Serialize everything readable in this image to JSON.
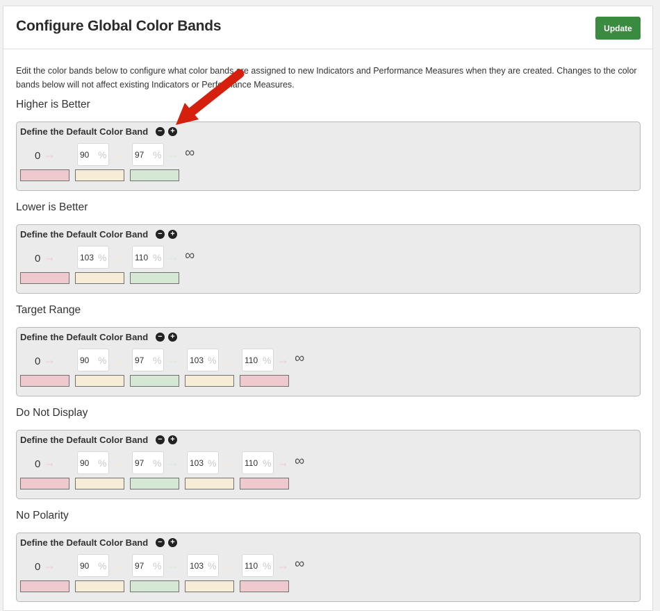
{
  "header": {
    "title": "Configure Global Color Bands",
    "update_label": "Update"
  },
  "description": "Edit the color bands below to configure what color bands are assigned to new Indicators and Performance Measures when they are created. Changes to the color bands below will not affect existing Indicators or Performance Measures.",
  "band_label": "Define the Default Color Band",
  "colors": {
    "red": "#efc9cd",
    "yellow": "#f7ecd6",
    "green": "#d4e8d3",
    "accent": "#3a8a3f"
  },
  "sections": [
    {
      "title": "Higher is Better",
      "start": "0",
      "thresholds": [
        "90",
        "97"
      ],
      "bands": [
        "red",
        "yellow",
        "green"
      ],
      "end": "∞"
    },
    {
      "title": "Lower is Better",
      "start": "0",
      "thresholds": [
        "103",
        "110"
      ],
      "bands": [
        "red",
        "yellow",
        "green"
      ],
      "end": "∞"
    },
    {
      "title": "Target Range",
      "start": "0",
      "thresholds": [
        "90",
        "97",
        "103",
        "110"
      ],
      "bands": [
        "red",
        "yellow",
        "green",
        "yellow",
        "red"
      ],
      "end": "∞"
    },
    {
      "title": "Do Not Display",
      "start": "0",
      "thresholds": [
        "90",
        "97",
        "103",
        "110"
      ],
      "bands": [
        "red",
        "yellow",
        "green",
        "yellow",
        "red"
      ],
      "end": "∞"
    },
    {
      "title": "No Polarity",
      "start": "0",
      "thresholds": [
        "90",
        "97",
        "103",
        "110"
      ],
      "bands": [
        "red",
        "yellow",
        "green",
        "yellow",
        "red"
      ],
      "end": "∞"
    }
  ],
  "icons": {
    "minus": "minus-circle-icon",
    "plus": "plus-circle-icon",
    "arrow": "arrow-right-icon",
    "infinity": "infinity-icon",
    "annotation": "red-annotation-arrow"
  },
  "symbols": {
    "minus": "−",
    "plus": "+",
    "arrow": "→",
    "percent": "%"
  }
}
